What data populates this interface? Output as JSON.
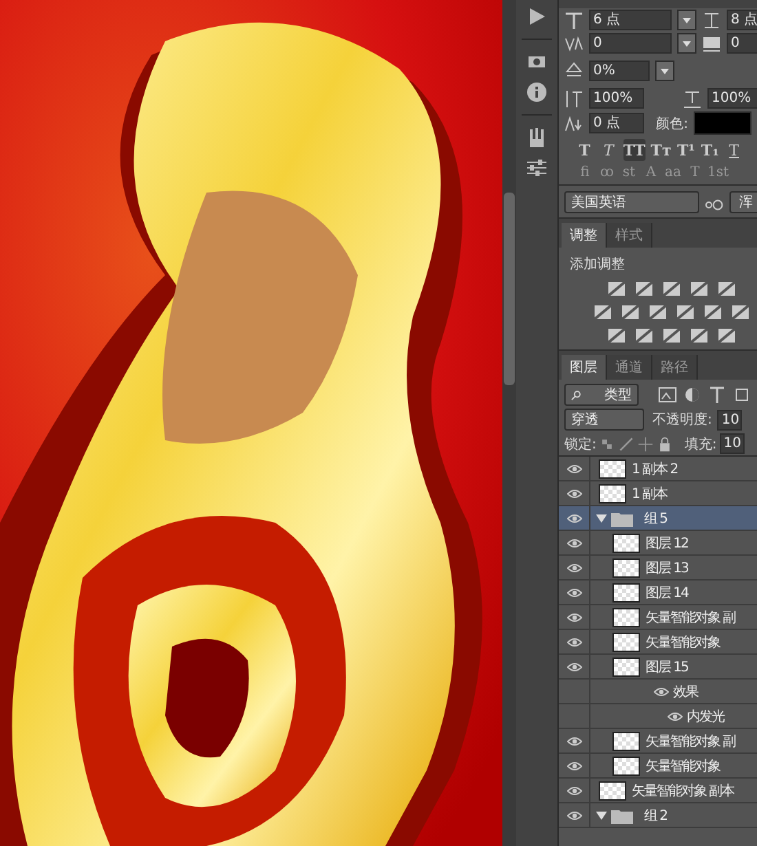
{
  "character": {
    "font_size": "6 点",
    "leading": "8 点",
    "kerning": "0",
    "tracking": "0",
    "tsume": "0%",
    "vertical_scale": "100%",
    "horizontal_scale": "100%",
    "baseline_shift": "0 点",
    "color_label": "颜色:",
    "style_buttons": [
      {
        "label": "T",
        "kind": "bold",
        "selected": false
      },
      {
        "label": "T",
        "kind": "italic",
        "selected": false
      },
      {
        "label": "TT",
        "kind": "bold",
        "selected": true
      },
      {
        "label": "Tт",
        "kind": "bold",
        "selected": false
      },
      {
        "label": "T¹",
        "kind": "bold",
        "selected": false
      },
      {
        "label": "T₁",
        "kind": "bold",
        "selected": false
      },
      {
        "label": "T",
        "kind": "underline",
        "selected": false
      }
    ],
    "opentype_buttons": [
      "fi",
      "ꝏ",
      "st",
      "A",
      "aa",
      "T",
      "1st"
    ],
    "language": "美国英语",
    "antialias": "浑"
  },
  "adjustments": {
    "tabs": [
      {
        "label": "调整",
        "selected": true
      },
      {
        "label": "样式",
        "selected": false
      }
    ],
    "heading": "添加调整"
  },
  "layers_panel": {
    "tabs": [
      {
        "label": "图层",
        "selected": true
      },
      {
        "label": "通道",
        "selected": false
      },
      {
        "label": "路径",
        "selected": false
      }
    ],
    "filter": "类型",
    "blend_mode": "穿透",
    "opacity_label": "不透明度:",
    "opacity": "10",
    "lock_label": "锁定:",
    "fill_label": "填充:",
    "fill": "10",
    "layers": [
      {
        "kind": "layer",
        "name": "1 副本 2",
        "visible": true,
        "selected": false
      },
      {
        "kind": "layer",
        "name": "1 副本",
        "visible": true,
        "selected": false
      },
      {
        "kind": "group",
        "name": "组 5",
        "visible": true,
        "selected": true,
        "expanded": true,
        "children": [
          {
            "kind": "layer",
            "name": "图层 12",
            "visible": true,
            "selected": false
          },
          {
            "kind": "layer",
            "name": "图层 13",
            "visible": true,
            "selected": false
          },
          {
            "kind": "layer",
            "name": "图层 14",
            "visible": true,
            "selected": false
          },
          {
            "kind": "layer",
            "name": "矢量智能对象 副",
            "visible": true,
            "selected": false
          },
          {
            "kind": "layer",
            "name": "矢量智能对象",
            "visible": true,
            "selected": false
          },
          {
            "kind": "layer",
            "name": "图层 15",
            "visible": true,
            "selected": false,
            "children": [
              {
                "kind": "effect",
                "name": "效果",
                "visible": true,
                "selected": false,
                "children": [
                  {
                    "kind": "effect",
                    "name": "内发光",
                    "visible": true,
                    "selected": false
                  }
                ]
              }
            ]
          },
          {
            "kind": "layer",
            "name": "矢量智能对象 副",
            "visible": true,
            "selected": false
          },
          {
            "kind": "layer",
            "name": "矢量智能对象",
            "visible": true,
            "selected": false
          }
        ]
      },
      {
        "kind": "layer",
        "name": "矢量智能对象 副本",
        "visible": true,
        "selected": false
      },
      {
        "kind": "group",
        "name": "组 2",
        "visible": true,
        "selected": false,
        "expanded": true
      }
    ]
  }
}
